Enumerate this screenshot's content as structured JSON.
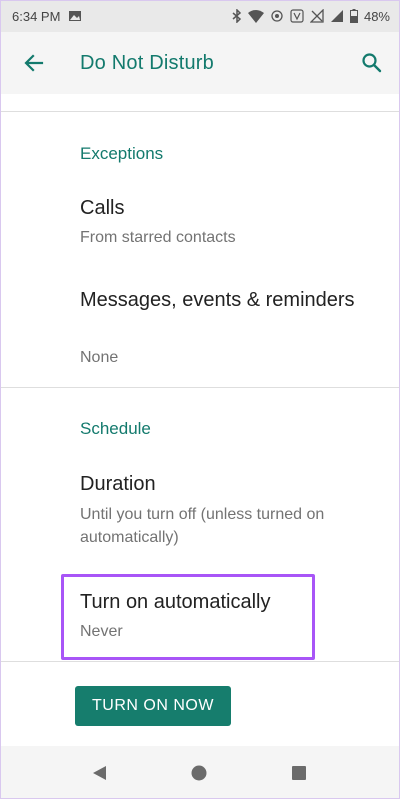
{
  "status_bar": {
    "time": "6:34 PM",
    "battery": "48%",
    "icons": [
      "image-icon",
      "bluetooth-icon",
      "wifi-icon",
      "hotspot-icon",
      "volte-icon",
      "data-off-icon",
      "signal-icon",
      "battery-icon"
    ]
  },
  "app_bar": {
    "title": "Do Not Disturb",
    "back_icon": "arrow-back-icon",
    "search_icon": "search-icon"
  },
  "sections": {
    "exceptions": {
      "header": "Exceptions",
      "calls": {
        "title": "Calls",
        "subtitle": "From starred contacts"
      },
      "messages": {
        "title": "Messages, events & reminders",
        "subtitle": "None"
      }
    },
    "schedule": {
      "header": "Schedule",
      "duration": {
        "title": "Duration",
        "subtitle": "Until you turn off (unless turned on automatically)"
      },
      "turn_on_automatically": {
        "title": "Turn on automatically",
        "subtitle": "Never"
      }
    }
  },
  "button": {
    "turn_on_now": "TURN ON NOW"
  },
  "colors": {
    "accent": "#137a6d",
    "button": "#167d6d",
    "highlight": "#a855f7"
  },
  "nav_bar": {
    "icons": [
      "nav-back-icon",
      "nav-home-icon",
      "nav-recents-icon"
    ]
  }
}
